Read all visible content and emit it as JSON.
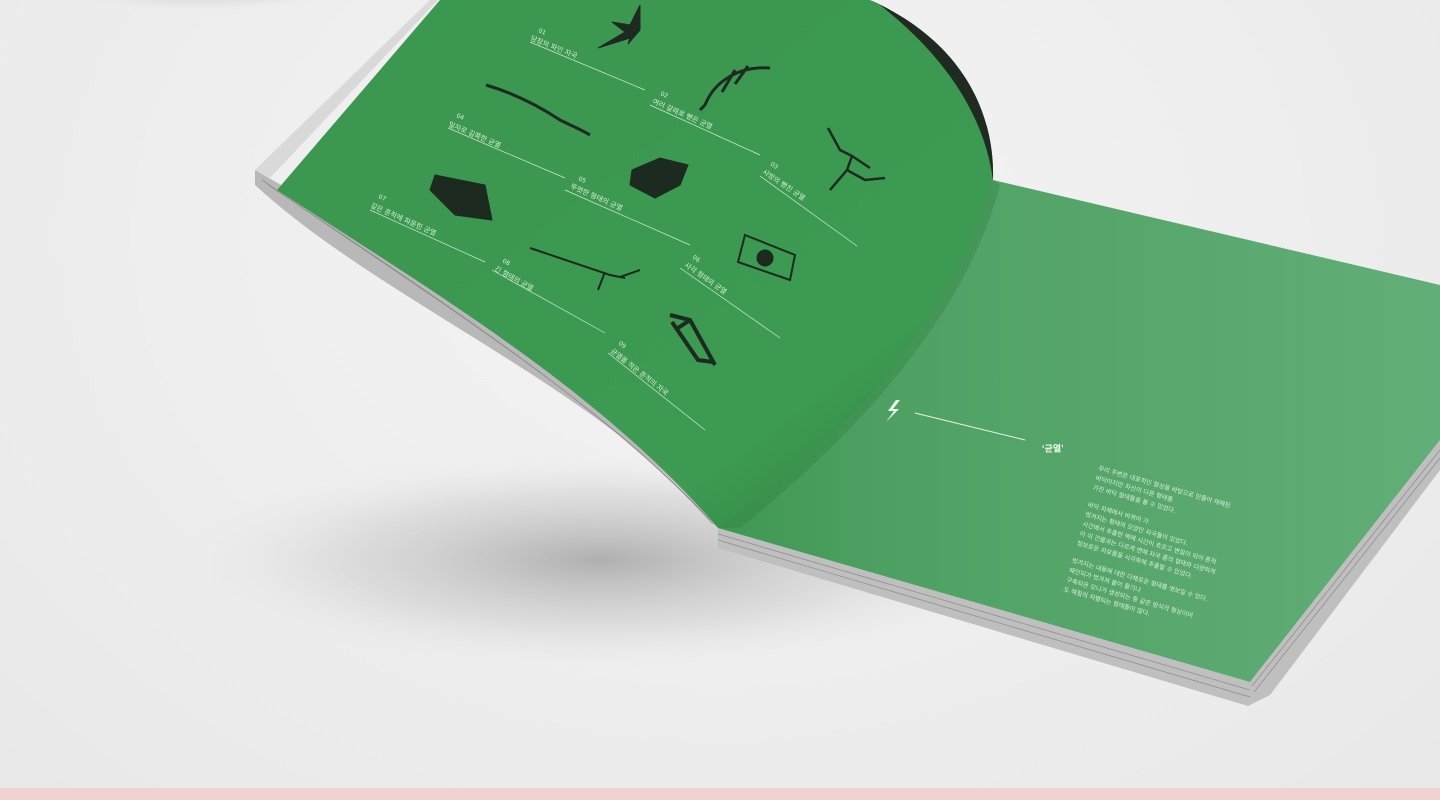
{
  "booklet": {
    "colors": {
      "page": "#3f9a52",
      "page_right": "#4fa264",
      "text": "#d7eed9",
      "ink": "#1d2a1f",
      "band": "#efd2d1"
    },
    "items": [
      {
        "num": "01",
        "label": "당장의 파인 자국"
      },
      {
        "num": "02",
        "label": "여러 갈래로 뻗은 균열"
      },
      {
        "num": "03",
        "label": "사방의 뻗친 균열"
      },
      {
        "num": "04",
        "label": "일자로 길쭉한 균열"
      },
      {
        "num": "05",
        "label": "뚜렷한 형태의 균열"
      },
      {
        "num": "06",
        "label": "사각 형태의 균열"
      },
      {
        "num": "07",
        "label": "깊은 흔적에 파묻힌 균열"
      },
      {
        "num": "08",
        "label": "긴 형태의 균열"
      },
      {
        "num": "09",
        "label": "균열을 적은 흔적의 자국"
      }
    ],
    "right_page": {
      "icon": "lightning-icon",
      "title": "'균열'",
      "paragraphs": [
        [
          "우리 주변은 대표적인 형상을 바탕으로 만들어 재해된",
          "바닥이지만 자신이 다른 형태를",
          "가진 바닥 형태들을 볼 수 있었다."
        ],
        [
          "바닥 자체에서 바뀌어 가",
          "벗겨지는 형태의 모양인 자국들이 있었다.",
          "시간에서 추출한 벽에 시간이 흐르고 변질이 되어 흔적",
          "이 이 건물과는 다르게 변해 자국 중의 형태와 다양하게",
          "정보로운 자료들을 시각화해 추출할 수 있었다."
        ],
        [
          "벗겨지는 내용에 대한 다채로운 형태를 엿보일 수 있다.",
          "패인되가 벗겨져 붙어 들기나",
          "구축되온 모니가 생성되는 등 같은 방식의 형상이어",
          "도 해칠의 차별되는 형태들이 많다."
        ]
      ]
    }
  }
}
